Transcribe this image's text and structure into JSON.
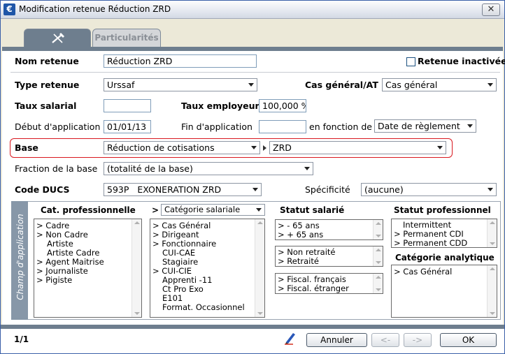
{
  "window": {
    "title": "Modification retenue Réduction ZRD",
    "close_glyph": "✕",
    "app_icon_glyph": "€"
  },
  "tabs": [
    {
      "icon": "tools-icon",
      "label": ""
    },
    {
      "label": "Particularités"
    }
  ],
  "form": {
    "nom_retenue": {
      "label": "Nom retenue",
      "value": "Réduction ZRD"
    },
    "retenue_inactivee": {
      "label": "Retenue inactivée",
      "checked": false
    },
    "type_retenue": {
      "label": "Type retenue",
      "value": "Urssaf"
    },
    "cas_general_at": {
      "label": "Cas général/AT",
      "value": "Cas général"
    },
    "taux_salarial": {
      "label": "Taux salarial",
      "value": ""
    },
    "taux_employeur": {
      "label": "Taux employeur",
      "value": "100,000 %"
    },
    "debut_application": {
      "label": "Début d'application",
      "value": "01/01/13"
    },
    "fin_application": {
      "label": "Fin d'application",
      "value": ""
    },
    "en_fonction_de": {
      "label": "en fonction de",
      "value": "Date de règlement"
    },
    "base": {
      "label": "Base",
      "value1": "Réduction de cotisations",
      "value2": "ZRD"
    },
    "fraction_base": {
      "label": "Fraction de la base",
      "value": "(totalité de la base)"
    },
    "code_ducs": {
      "label": "Code DUCS",
      "value": "593P   EXONERATION ZRD"
    },
    "specificite": {
      "label": "Spécificité",
      "value": "(aucune)"
    }
  },
  "champ": {
    "side_label": "Champ d'application",
    "cat_pro": {
      "header": "Cat. professionnelle",
      "items": [
        {
          "mark": ">",
          "text": "Cadre"
        },
        {
          "mark": ">",
          "text": "Non Cadre"
        },
        {
          "mark": "",
          "text": "Artiste"
        },
        {
          "mark": "",
          "text": "Artiste Cadre"
        },
        {
          "mark": ">",
          "text": "Agent Maitrise"
        },
        {
          "mark": ">",
          "text": "Journaliste"
        },
        {
          "mark": ">",
          "text": "Pigiste"
        }
      ]
    },
    "cat_sal": {
      "mark": ">",
      "select": "Catégorie salariale",
      "items": [
        {
          "mark": ">",
          "text": "Cas Général"
        },
        {
          "mark": ">",
          "text": "Dirigeant"
        },
        {
          "mark": ">",
          "text": "Fonctionnaire"
        },
        {
          "mark": "",
          "text": "CUI-CAE"
        },
        {
          "mark": "",
          "text": "Stagiaire"
        },
        {
          "mark": ">",
          "text": "CUI-CIE"
        },
        {
          "mark": "",
          "text": "Apprenti -11"
        },
        {
          "mark": "",
          "text": "Ct Pro Exo"
        },
        {
          "mark": "",
          "text": "E101"
        },
        {
          "mark": "",
          "text": "Format. Occasionnel"
        }
      ]
    },
    "statut_salarie": {
      "header": "Statut salarié",
      "age": [
        {
          "mark": ">",
          "text": " - 65 ans"
        },
        {
          "mark": ">",
          "text": " + 65 ans"
        }
      ],
      "retraite": [
        {
          "mark": ">",
          "text": "Non retraité"
        },
        {
          "mark": ">",
          "text": "Retraité"
        }
      ],
      "fiscal": [
        {
          "mark": ">",
          "text": "Fiscal. français"
        },
        {
          "mark": ">",
          "text": "Fiscal. étranger"
        }
      ]
    },
    "statut_pro": {
      "header": "Statut professionnel",
      "items": [
        {
          "mark": "",
          "text": "Intermittent"
        },
        {
          "mark": ">",
          "text": "Permanent CDI"
        },
        {
          "mark": ">",
          "text": "Permanent CDD"
        }
      ]
    },
    "cat_analytique": {
      "header": "Catégorie analytique",
      "items": [
        {
          "mark": ">",
          "text": "Cas Général"
        }
      ]
    }
  },
  "footer": {
    "counter": "1/1",
    "annuler": "Annuler",
    "prev": "<-",
    "next": "->",
    "ok": "OK"
  }
}
